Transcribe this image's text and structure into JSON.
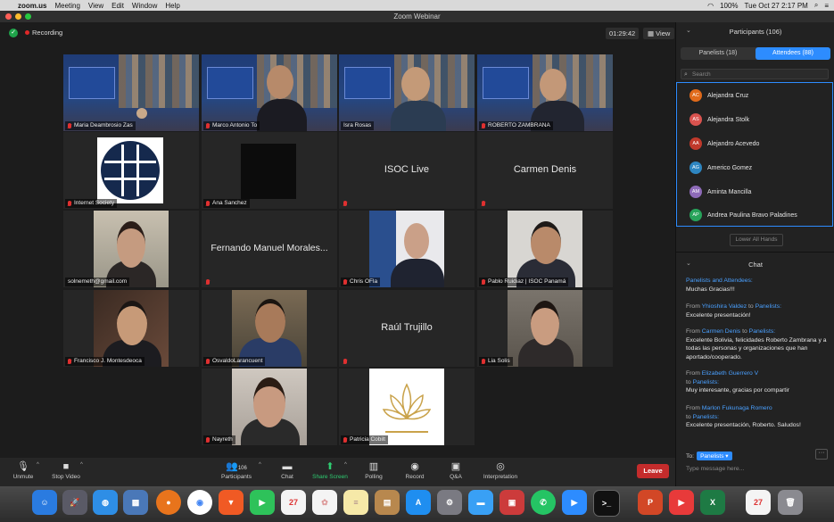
{
  "menubar": {
    "app": "zoom.us",
    "items": [
      "Meeting",
      "View",
      "Edit",
      "Window",
      "Help"
    ],
    "battery": "100%",
    "datetime": "Tue Oct 27  2:17 PM"
  },
  "window": {
    "title": "Zoom Webinar"
  },
  "status": {
    "recording": "Recording",
    "elapsed": "01:29:42",
    "view": "View"
  },
  "tiles": [
    {
      "name": "Maria Deambrosio Zas",
      "kind": "conf"
    },
    {
      "name": "Marco Antonio To",
      "kind": "conf-person"
    },
    {
      "name": "Isra Rosas",
      "kind": "conf-person",
      "active": true
    },
    {
      "name": "ROBERTO ZAMBRANA",
      "kind": "conf-person"
    },
    {
      "name": "Internet Society",
      "kind": "logo"
    },
    {
      "name": "Ana Sanchez",
      "kind": "black"
    },
    {
      "name": "",
      "center": "ISOC Live",
      "kind": "text"
    },
    {
      "name": "",
      "center": "Carmen Denis",
      "kind": "text"
    },
    {
      "name": "solnemeth@gmail.com",
      "kind": "person"
    },
    {
      "name": "",
      "center": "Fernando Manuel Morales...",
      "kind": "text"
    },
    {
      "name": "Chris OFla",
      "kind": "person"
    },
    {
      "name": "Pablo Ruidiaz | ISOC Panamá",
      "kind": "person"
    },
    {
      "name": "Francisco J. Montesdeoca",
      "kind": "person"
    },
    {
      "name": "OsvaldoLarancuent",
      "kind": "person"
    },
    {
      "name": "",
      "center": "Raúl Trujillo",
      "kind": "text"
    },
    {
      "name": "Lia Solis",
      "kind": "person"
    },
    {
      "name": "Nayreth",
      "kind": "person"
    },
    {
      "name": "Patricia Cobilt",
      "kind": "lotus"
    }
  ],
  "toolbar": {
    "unmute": "Unmute",
    "stop_video": "Stop Video",
    "participants": "Participants",
    "participants_count": "106",
    "chat": "Chat",
    "share": "Share Screen",
    "polling": "Polling",
    "record": "Record",
    "qa": "Q&A",
    "interpretation": "Interpretation",
    "leave": "Leave"
  },
  "panel": {
    "title": "Participants (106)",
    "tab_panelists": "Panelists (18)",
    "tab_attendees": "Attendees (88)",
    "search_placeholder": "Search",
    "attendees": [
      {
        "initials": "AC",
        "name": "Alejandra Cruz",
        "color": "#e06a1a"
      },
      {
        "initials": "AS",
        "name": "Alejandra Stolk",
        "color": "#d9534f"
      },
      {
        "initials": "AA",
        "name": "Alejandro Acevedo",
        "color": "#c0392b"
      },
      {
        "initials": "AG",
        "name": "Americo Gomez",
        "color": "#2e86c1"
      },
      {
        "initials": "AM",
        "name": "Aminta Mancilla",
        "color": "#8e6bb8"
      },
      {
        "initials": "AP",
        "name": "Andrea Paulina Bravo Paladines",
        "color": "#27a35a"
      }
    ],
    "lower_all": "Lower All Hands",
    "chat_title": "Chat",
    "messages": [
      {
        "header": "Panelists and Attendees:",
        "text": "Muchas Gracias!!!"
      },
      {
        "from": "From ",
        "sender": "Yhioshira Valdez",
        "to": " to ",
        "target": "Panelists:",
        "text": "Excelente presentación!"
      },
      {
        "from": "From ",
        "sender": "Carmen Denis",
        "to": " to ",
        "target": "Panelists:",
        "text": "Excelente Bolivia, felicidades Roberto Zambrana y a todas las personas y organizaciones que han aportado/cooperado."
      },
      {
        "from": "From ",
        "sender": "Elizabeth Guerrero V",
        "to": " to ",
        "target": "Panelists:",
        "text": "Muy interesante, gracias por compartir"
      },
      {
        "from": "From ",
        "sender": "Marlon Fukunaga Romero",
        "to": " to ",
        "target": "Panelists:",
        "text": "Excelente presentación, Roberto. Saludos!"
      }
    ],
    "to_label": "To:",
    "to_value": "Panelists",
    "input_placeholder": "Type message here..."
  },
  "dock": {
    "calendar_day": "27"
  }
}
